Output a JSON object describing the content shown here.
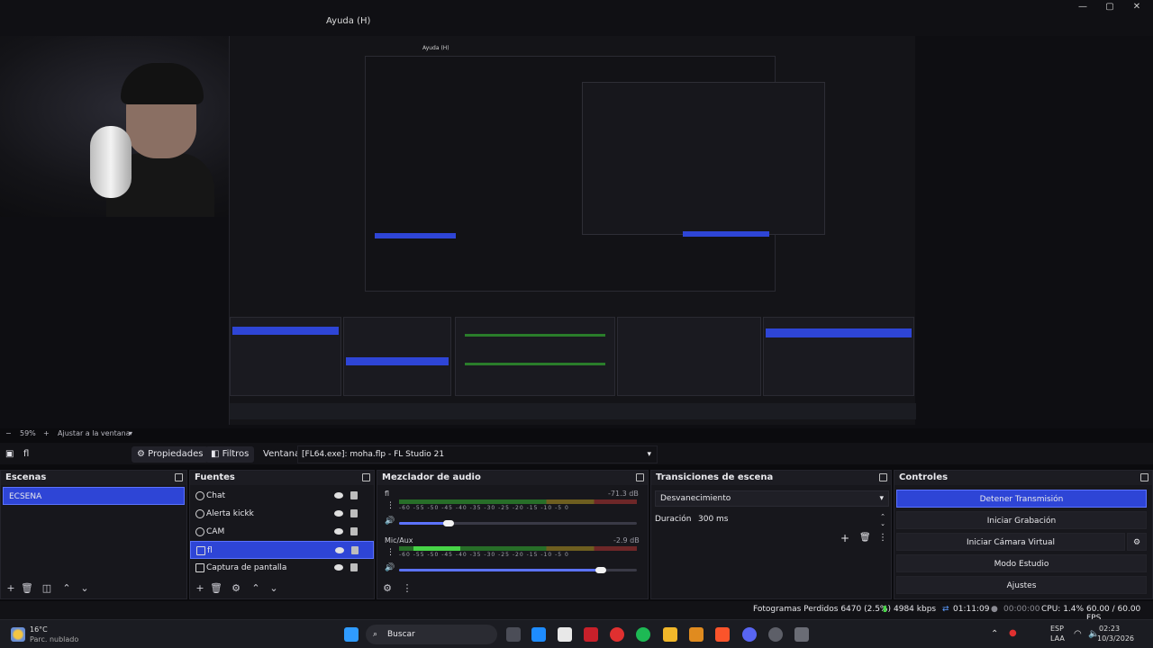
{
  "menu": {
    "help": "Ayuda (H)"
  },
  "nested": {
    "help": "Ayuda (H)",
    "scenes_header": "Escenas",
    "sources_header": "Fuentes",
    "mixer_header": "Mezclador de audio",
    "transitions_header": "Transiciones de escena",
    "controls_header": "Controles",
    "stop_stream": "Detener Transmisión"
  },
  "zoom": {
    "value": "59%",
    "fit_label": "Ajustar a la ventana"
  },
  "toolbar": {
    "selected_source": "fl",
    "properties": "Propiedades",
    "filters": "Filtros",
    "window_label": "Ventana",
    "window_value": "[FL64.exe]: moha.flp - FL Studio 21"
  },
  "scenes": {
    "header": "Escenas",
    "items": [
      "ECSENA"
    ]
  },
  "sources": {
    "header": "Fuentes",
    "items": [
      "Chat",
      "Alerta kickk",
      "CAM",
      "fl",
      "Captura de pantalla"
    ]
  },
  "mixer": {
    "header": "Mezclador de audio",
    "tracks": [
      {
        "name": "fl",
        "db": "-71.3 dB",
        "volume": 0.21
      },
      {
        "name": "Mic/Aux",
        "db": "-2.9 dB",
        "volume": 0.85
      }
    ],
    "ticks": [
      "-60",
      "-55",
      "-50",
      "-45",
      "-40",
      "-35",
      "-30",
      "-25",
      "-20",
      "-15",
      "-10",
      "-5",
      "0"
    ]
  },
  "transitions": {
    "header": "Transiciones de escena",
    "selected": "Desvanecimiento",
    "duration_label": "Duración",
    "duration_value": "300 ms"
  },
  "controls": {
    "header": "Controles",
    "stop_stream": "Detener Transmisión",
    "start_recording": "Iniciar Grabación",
    "start_virtual_cam": "Iniciar Cámara Virtual",
    "studio_mode": "Modo Estudio",
    "settings": "Ajustes"
  },
  "status": {
    "dropped_frames": "Fotogramas Perdidos 6470 (2.5%)",
    "bitrate": "4984 kbps",
    "stream_time": "01:11:09",
    "rec_time": "00:00:00",
    "cpu": "CPU: 1.4%",
    "fps": "60.00 / 60.00 FPS"
  },
  "taskbar": {
    "temperature": "16°C",
    "weather": "Parc. nublado",
    "search": "Buscar",
    "lang": "ESP",
    "region": "LAA",
    "time": "02:23",
    "date": "10/3/2026"
  },
  "colors": {
    "accent": "#2e45d6",
    "panel": "#17171c",
    "background": "#0b0b0e"
  }
}
